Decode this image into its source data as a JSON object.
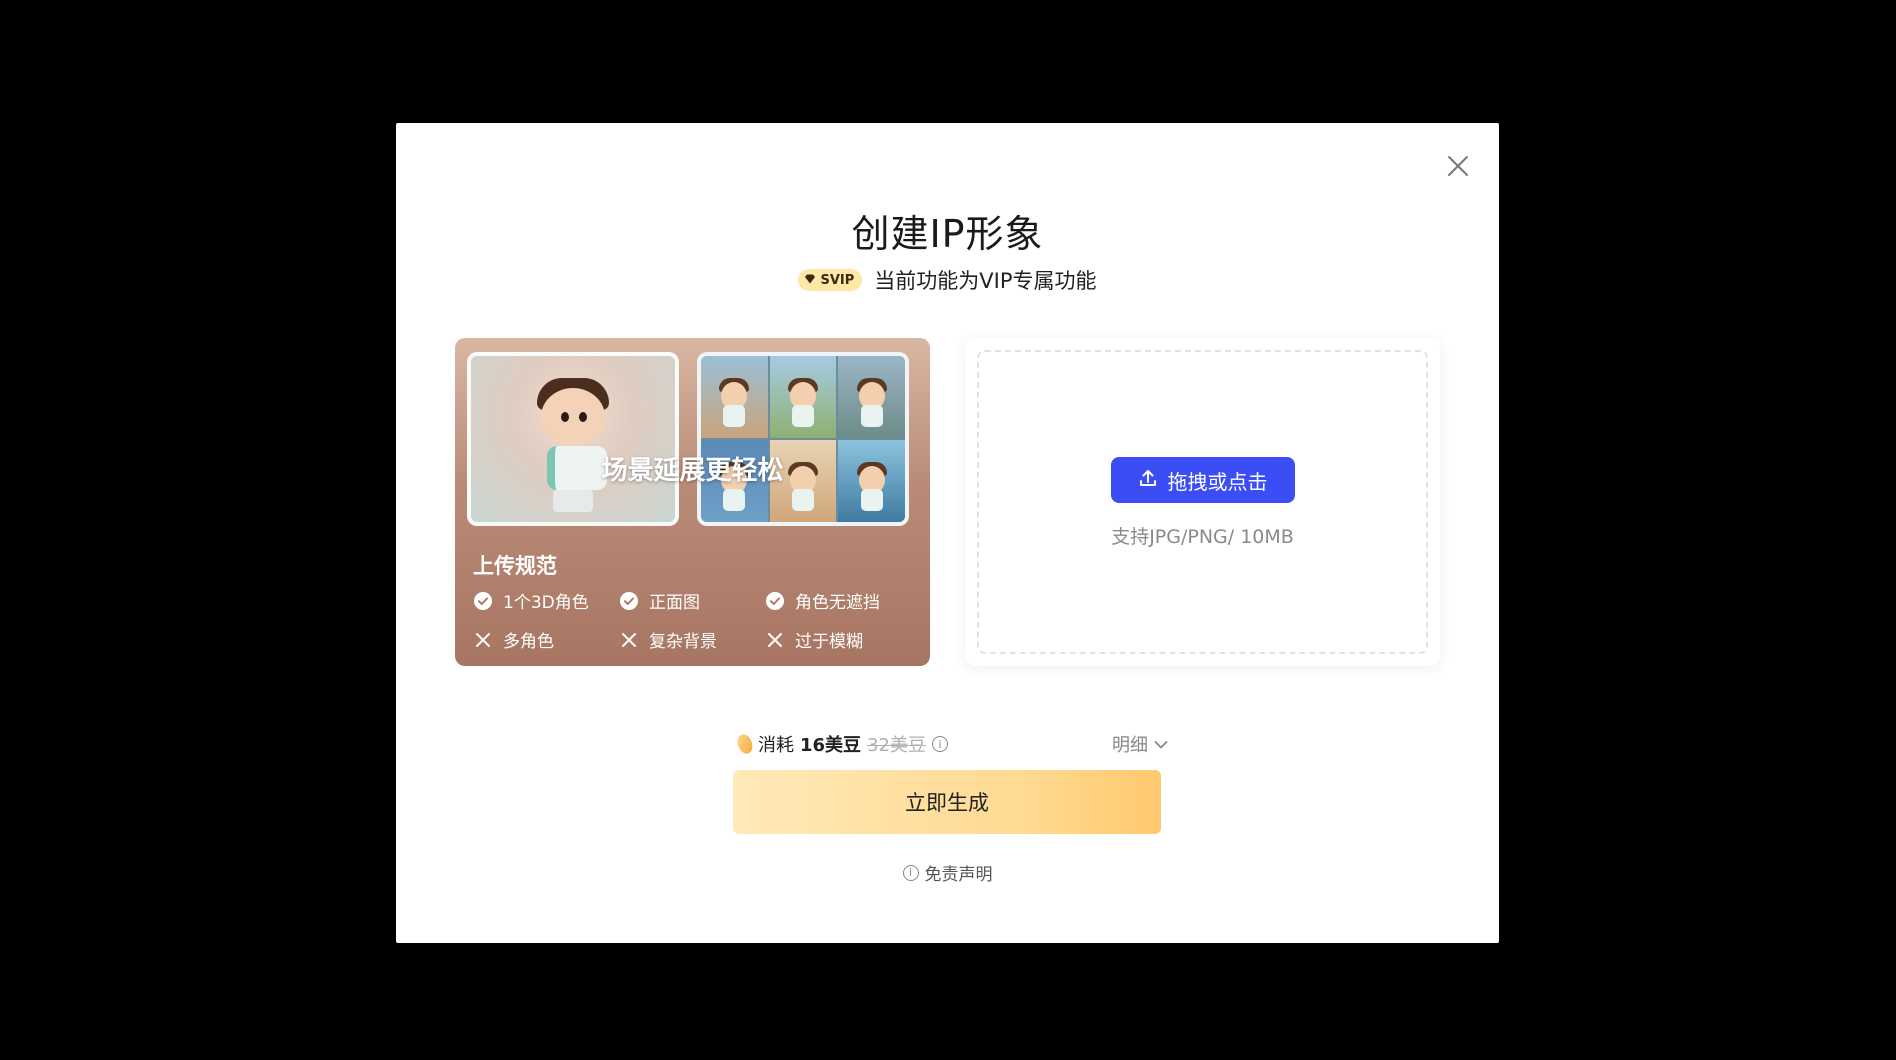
{
  "modal": {
    "title": "创建IP形象",
    "badge": "SVIP",
    "subtitle": "当前功能为VIP专属功能"
  },
  "example": {
    "overlay_text": "场景延展更轻松",
    "rules_title": "上传规范",
    "rules": [
      {
        "type": "ok",
        "label": "1个3D角色"
      },
      {
        "type": "ok",
        "label": "正面图"
      },
      {
        "type": "ok",
        "label": "角色无遮挡"
      },
      {
        "type": "no",
        "label": "多角色"
      },
      {
        "type": "no",
        "label": "复杂背景"
      },
      {
        "type": "no",
        "label": "过于模糊"
      }
    ]
  },
  "upload": {
    "button_label": "拖拽或点击",
    "hint": "支持JPG/PNG/ 10MB"
  },
  "cost": {
    "prefix": "消耗",
    "amount": "16美豆",
    "original": "32美豆",
    "detail_label": "明细"
  },
  "actions": {
    "generate_label": "立即生成",
    "disclaimer_label": "免责声明"
  },
  "colors": {
    "primary_blue": "#3b4ef5",
    "generate_gradient_start": "#ffe9b9",
    "generate_gradient_end": "#ffc96e"
  }
}
